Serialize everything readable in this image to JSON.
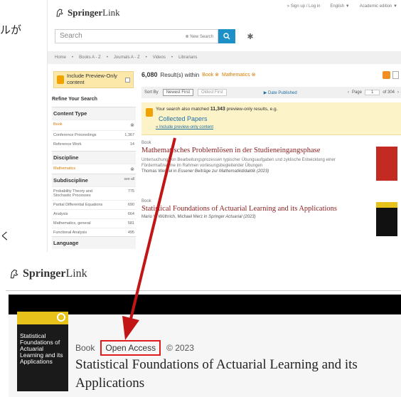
{
  "annotations": {
    "jp_text_top": "ルが",
    "jp_text_mid": "く"
  },
  "colors": {
    "springer_blue": "#1d90c8",
    "title_red": "#8b2020",
    "accent_orange": "#d47b00",
    "highlight_red": "#e01b1b",
    "notice_bg": "#fdf3c9"
  },
  "search_page": {
    "logo_brand": "Springer",
    "logo_link": "Link",
    "top_links": [
      "» Sign up / Log in",
      "English ▼",
      "Academic edition ▼"
    ],
    "search_placeholder": "Search",
    "new_search": "New Search",
    "breadcrumbs": [
      "Home",
      "•",
      "Books A - Z",
      "•",
      "Journals A - Z",
      "•",
      "Videos",
      "•",
      "Librarians"
    ],
    "preview_label": "Include Preview-Only content",
    "refine_heading": "Refine Your Search",
    "content_type": {
      "title": "Content Type",
      "rows": [
        {
          "label": "Book",
          "count": "⊗"
        },
        {
          "label": "Conference Proceedings",
          "count": "1,367"
        },
        {
          "label": "Reference Work",
          "count": "14"
        }
      ]
    },
    "discipline": {
      "title": "Discipline",
      "rows": [
        {
          "label": "Mathematics",
          "count": "⊗"
        }
      ]
    },
    "subdiscipline": {
      "title": "Subdiscipline",
      "see_all": "see all",
      "rows": [
        {
          "label": "Probability Theory and Stochastic Processes",
          "count": "775"
        },
        {
          "label": "Partial Differential Equations",
          "count": "690"
        },
        {
          "label": "Analysis",
          "count": "664"
        },
        {
          "label": "Mathematics, general",
          "count": "581"
        },
        {
          "label": "Functional Analysis",
          "count": "495"
        }
      ]
    },
    "language_title": "Language",
    "results_count": "6,080",
    "results_text": "Result(s) within",
    "filter_book": "Book",
    "filter_math": "Mathematics",
    "sort_label": "Sort By",
    "sort_newest": "Newest First",
    "sort_oldest": "Oldest First",
    "date_published": "Date Published",
    "page_label": "Page",
    "page_num": "1",
    "page_of": "of 304",
    "notice_line": "Your search also matched",
    "notice_count": "11,343",
    "notice_rest": "preview-only results, e.g.",
    "notice_collected": "Collected Papers",
    "notice_include": "» Include preview-only content",
    "results": [
      {
        "type": "Book",
        "title": "Mathematisches Problemlösen in der Studieneingangsphase",
        "snippet": "Untersuchung von Bearbeitungsprozessen typischer Übungsaufgaben und zyklische Entwicklung einer Fördermaßnahme im Rahmen vorlesungsbegleitender Übungen",
        "authors": "Thomas Wenzel in",
        "series": "Essener Beiträge zur Mathematikdidaktik (2023)"
      },
      {
        "type": "Book",
        "title": "Statistical Foundations of Actuarial Learning and its Applications",
        "snippet": "",
        "authors": "Mario V. Wüthrich, Michael Merz in",
        "series": "Springer Actuarial (2023)"
      }
    ]
  },
  "book_page": {
    "logo_brand": "Springer",
    "logo_link": "Link",
    "cover_title": "Statistical Foundations of Actuarial Learning and its Applications",
    "type": "Book",
    "open_access": "Open Access",
    "year": "© 2023",
    "title": "Statistical Foundations of Actuarial Learning and its Applications"
  }
}
